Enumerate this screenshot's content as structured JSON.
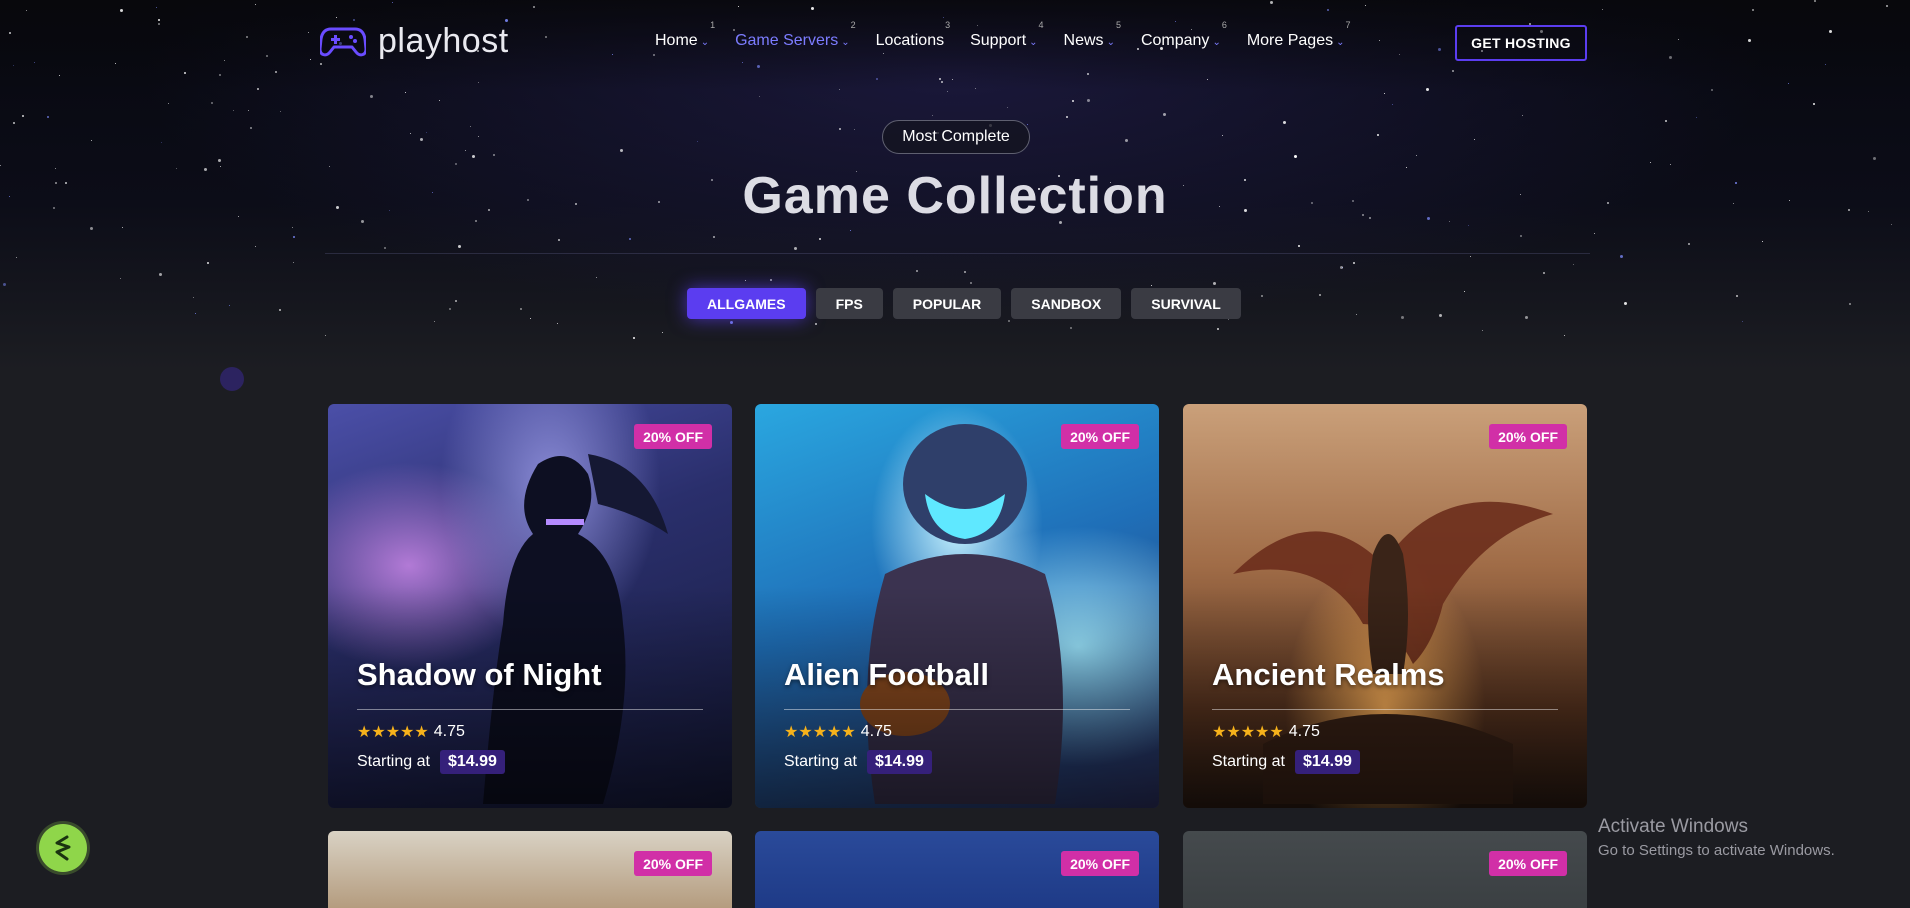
{
  "brand": {
    "name": "playhost"
  },
  "nav": {
    "items": [
      {
        "label": "Home",
        "num": "1",
        "has_dropdown": true
      },
      {
        "label": "Game Servers",
        "num": "2",
        "has_dropdown": true,
        "active": true
      },
      {
        "label": "Locations",
        "num": "3",
        "has_dropdown": false
      },
      {
        "label": "Support",
        "num": "4",
        "has_dropdown": true
      },
      {
        "label": "News",
        "num": "5",
        "has_dropdown": true
      },
      {
        "label": "Company",
        "num": "6",
        "has_dropdown": true
      },
      {
        "label": "More Pages",
        "num": "7",
        "has_dropdown": true
      }
    ],
    "cta_label": "GET HOSTING"
  },
  "hero": {
    "kicker": "Most Complete",
    "title": "Game Collection"
  },
  "filters": [
    {
      "label": "ALLGAMES",
      "active": true
    },
    {
      "label": "FPS",
      "active": false
    },
    {
      "label": "POPULAR",
      "active": false
    },
    {
      "label": "SANDBOX",
      "active": false
    },
    {
      "label": "SURVIVAL",
      "active": false
    }
  ],
  "cards": [
    {
      "title": "Shadow of Night",
      "badge": "20% OFF",
      "rating": "4.75",
      "stars": 5,
      "price_label": "Starting at",
      "price": "$14.99"
    },
    {
      "title": "Alien Football",
      "badge": "20% OFF",
      "rating": "4.75",
      "stars": 5,
      "price_label": "Starting at",
      "price": "$14.99"
    },
    {
      "title": "Ancient Realms",
      "badge": "20% OFF",
      "rating": "4.75",
      "stars": 5,
      "price_label": "Starting at",
      "price": "$14.99"
    }
  ],
  "cards_lower": [
    {
      "badge": "20% OFF"
    },
    {
      "badge": "20% OFF"
    },
    {
      "badge": "20% OFF"
    }
  ],
  "windows_watermark": {
    "title": "Activate Windows",
    "subtitle": "Go to Settings to activate Windows."
  },
  "colors": {
    "accent": "#5b3df0",
    "nav_active": "#7c7cff",
    "badge": "#d12fa7",
    "star": "#f6b21b",
    "chat_button": "#8fd64a"
  }
}
